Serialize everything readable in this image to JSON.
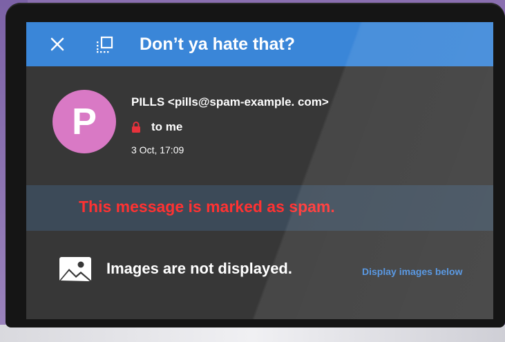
{
  "header": {
    "subject": "Don’t ya hate that?",
    "close_icon": "close-icon",
    "label_icon": "label-icon",
    "color": "#3a86d8"
  },
  "message": {
    "avatar_letter": "P",
    "avatar_color": "#d979c5",
    "sender": "PILLS <pills@spam-example. com>",
    "recipient": "to me",
    "date": "3 Oct,  17:09"
  },
  "spam_notice": {
    "text": "This message is marked as spam.",
    "color": "#ff3232"
  },
  "images_notice": {
    "text": "Images are not displayed.",
    "link": "Display images below",
    "icon": "image-icon"
  }
}
